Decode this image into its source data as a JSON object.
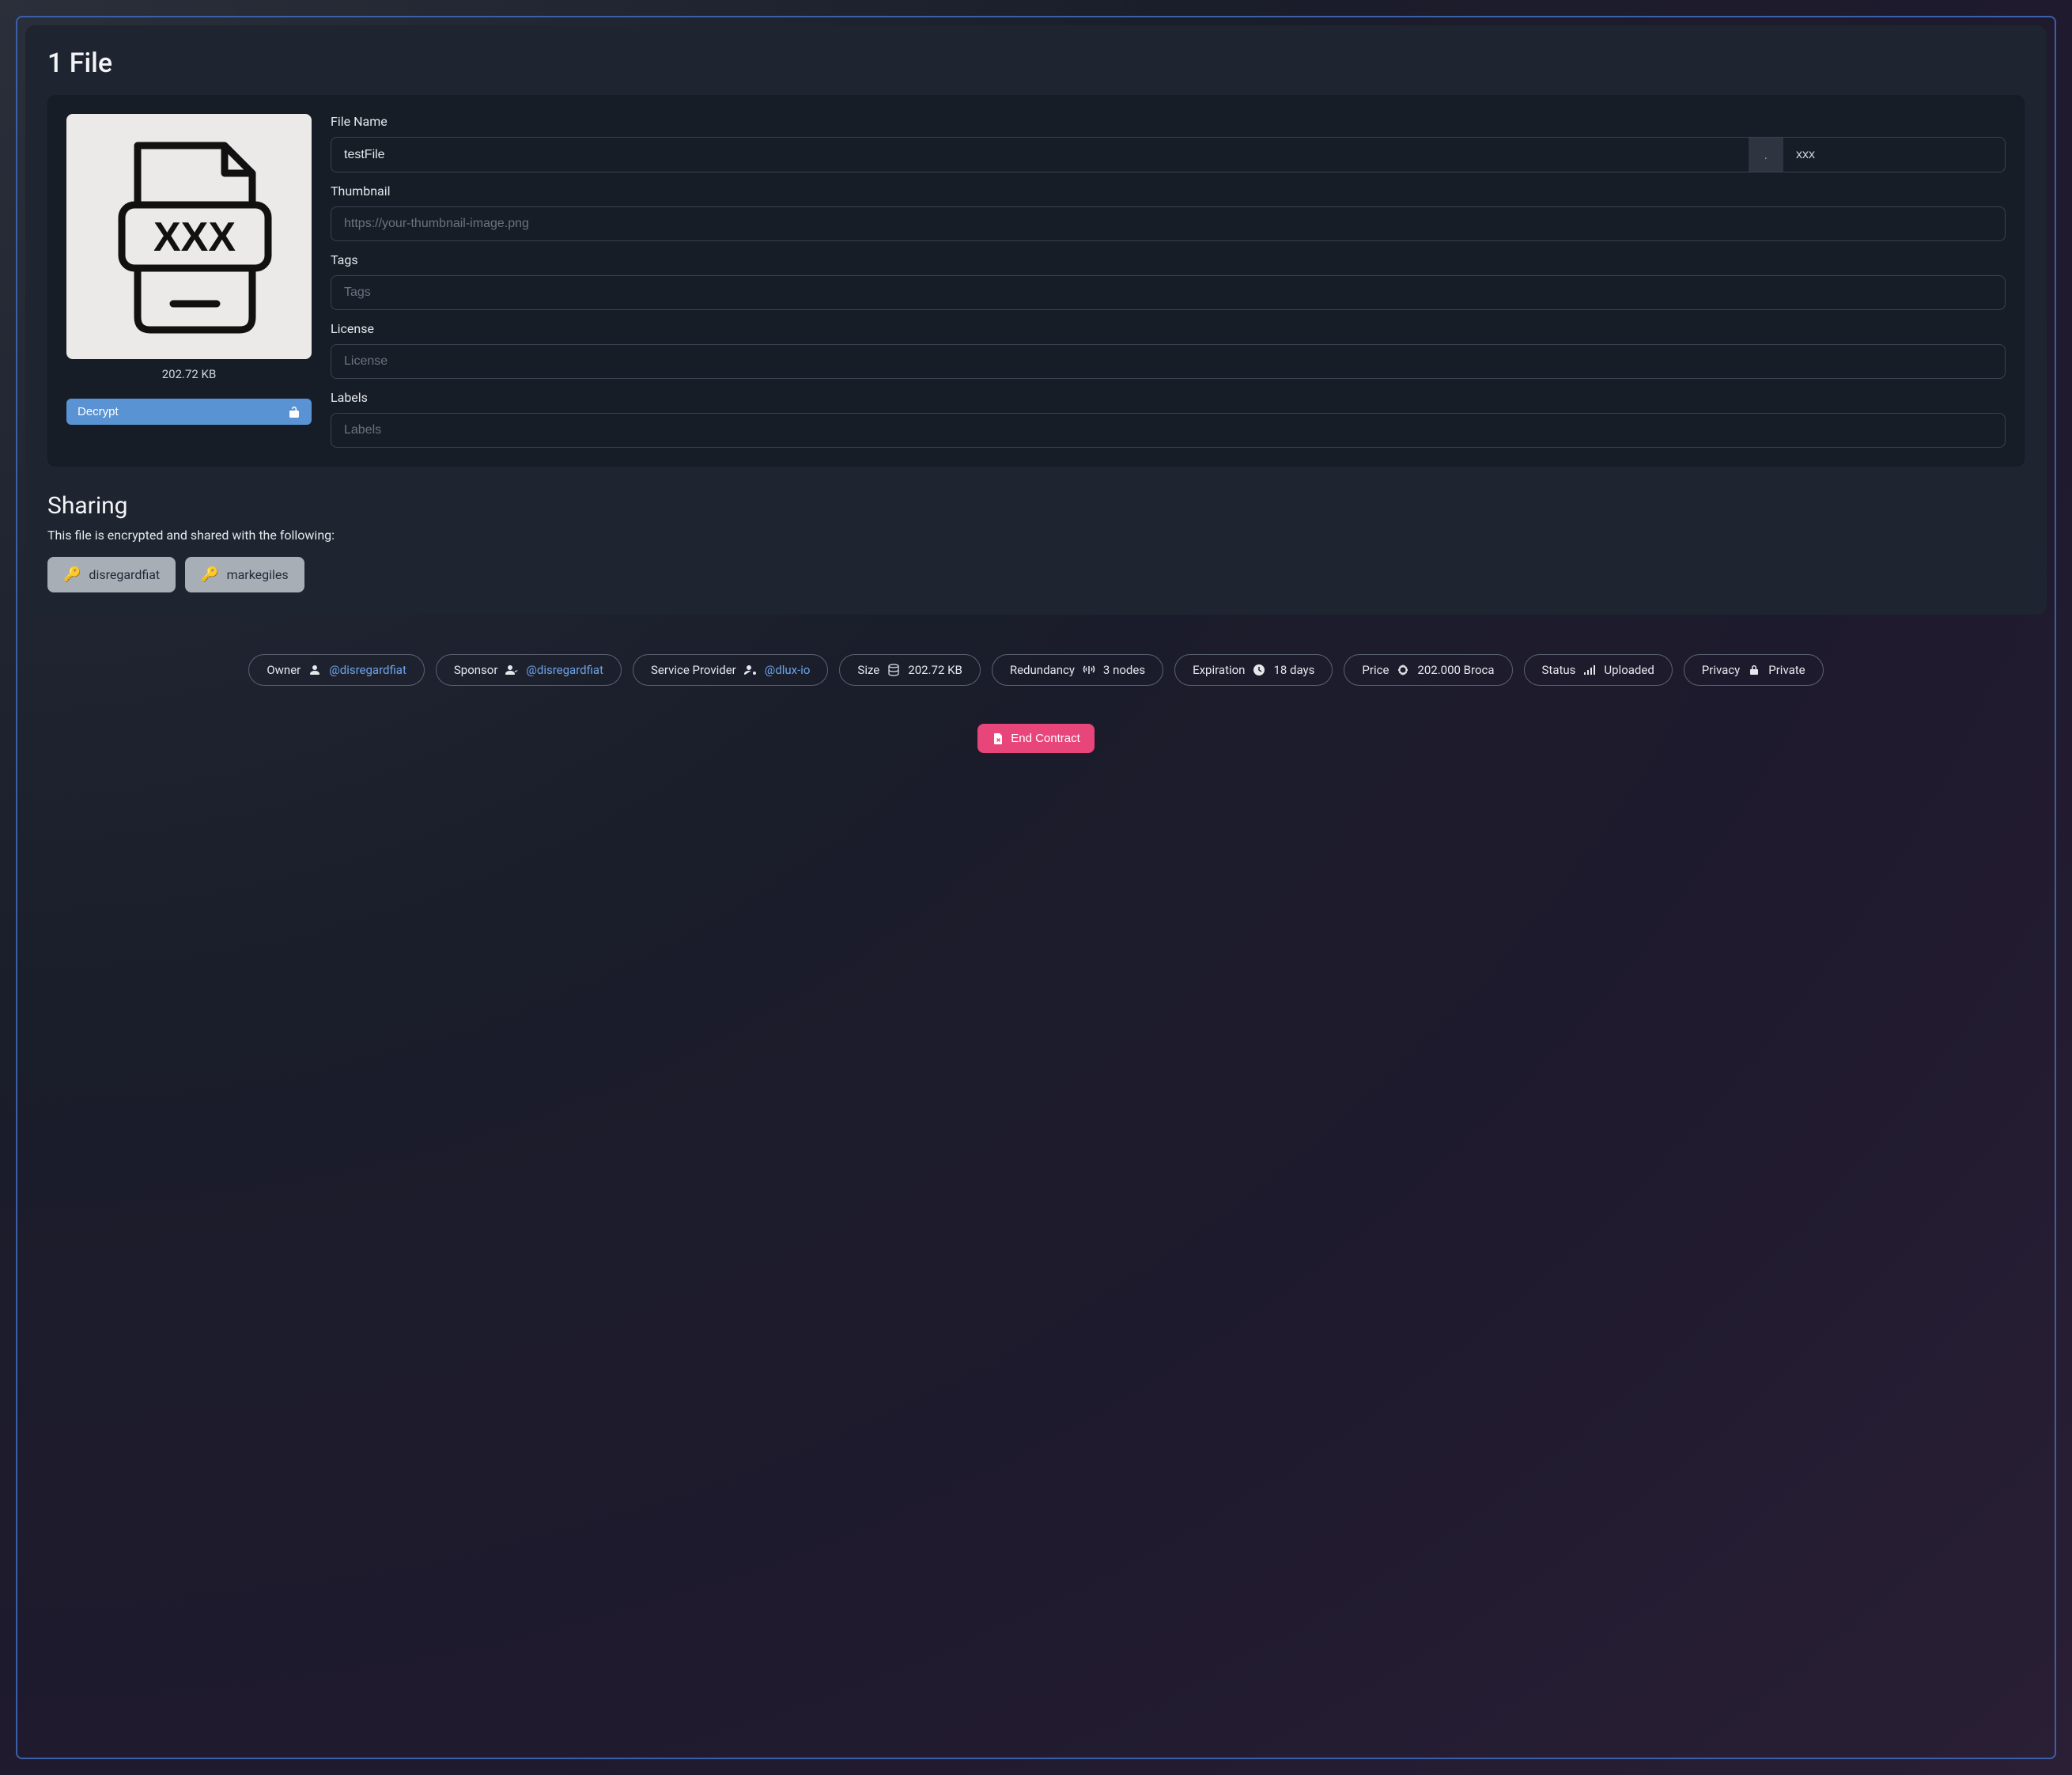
{
  "header": {
    "title": "1 File"
  },
  "file": {
    "preview_label": "XXX",
    "size": "202.72 KB",
    "decrypt_label": "Decrypt"
  },
  "form": {
    "filename_label": "File Name",
    "filename_value": "testFile",
    "extension_value": "xxx",
    "dot": ".",
    "thumbnail_label": "Thumbnail",
    "thumbnail_placeholder": "https://your-thumbnail-image.png",
    "tags_label": "Tags",
    "tags_placeholder": "Tags",
    "license_label": "License",
    "license_placeholder": "License",
    "labels_label": "Labels",
    "labels_placeholder": "Labels"
  },
  "sharing": {
    "title": "Sharing",
    "subtitle": "This file is encrypted and shared with the following:",
    "users": [
      {
        "name": "disregardfiat"
      },
      {
        "name": "markegiles"
      }
    ]
  },
  "pills": {
    "owner": {
      "label": "Owner",
      "value": "@disregardfiat"
    },
    "sponsor": {
      "label": "Sponsor",
      "value": "@disregardfiat"
    },
    "provider": {
      "label": "Service Provider",
      "value": "@dlux-io"
    },
    "size": {
      "label": "Size",
      "value": "202.72 KB"
    },
    "redundancy": {
      "label": "Redundancy",
      "value": "3 nodes"
    },
    "expiration": {
      "label": "Expiration",
      "value": "18 days"
    },
    "price": {
      "label": "Price",
      "value": "202.000 Broca"
    },
    "status": {
      "label": "Status",
      "value": "Uploaded"
    },
    "privacy": {
      "label": "Privacy",
      "value": "Private"
    }
  },
  "actions": {
    "end_contract": "End Contract"
  }
}
